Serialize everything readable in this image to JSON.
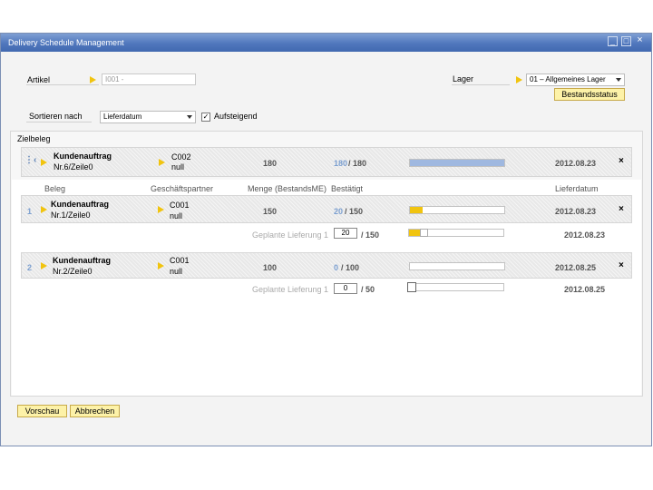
{
  "window": {
    "title": "Delivery Schedule Management"
  },
  "article": {
    "label": "Artikel",
    "value": "I001 - "
  },
  "warehouse": {
    "label": "Lager",
    "value": "01 – Allgemeines Lager",
    "status_button": "Bestandsstatus"
  },
  "sort": {
    "label": "Sortieren nach",
    "value": "Lieferdatum",
    "ascending_label": "Aufsteigend",
    "ascending_checked": true
  },
  "target_section": {
    "label": "Zielbeleg"
  },
  "target_doc": {
    "doc_type": "Kundenauftrag",
    "doc_ref": "Nr.6/Zeile0",
    "partner_code": "C002",
    "partner_name": "null",
    "quantity": "180",
    "confirmed": "180",
    "confirmed_total": "/ 180",
    "progress": 1.0,
    "date": "2012.08.23",
    "close": "×"
  },
  "columns": {
    "doc": "Beleg",
    "partner": "Geschäftspartner",
    "quantity": "Menge (BestandsME)",
    "confirmed": "Bestätigt",
    "date": "Lieferdatum"
  },
  "sources": [
    {
      "index": "1",
      "doc_type": "Kundenauftrag",
      "doc_ref": "Nr.1/Zeile0",
      "partner_code": "C001",
      "partner_name": "null",
      "quantity": "150",
      "confirmed": "20",
      "confirmed_total": "/ 150",
      "progress": 0.133,
      "date": "2012.08.23",
      "close": "×",
      "planned_label": "Geplante Lieferung 1",
      "planned_value": "20",
      "planned_total": "/ 150",
      "planned_progress": 0.133,
      "planned_date": "2012.08.23"
    },
    {
      "index": "2",
      "doc_type": "Kundenauftrag",
      "doc_ref": "Nr.2/Zeile0",
      "partner_code": "C001",
      "partner_name": "null",
      "quantity": "100",
      "confirmed": "0",
      "confirmed_total": "/ 100",
      "progress": 0.0,
      "date": "2012.08.25",
      "close": "×",
      "planned_label": "Geplante Lieferung 1",
      "planned_value": "0",
      "planned_total": "/ 50",
      "planned_progress": 0.0,
      "planned_date": "2012.08.25"
    }
  ],
  "footer": {
    "preview": "Vorschau",
    "cancel": "Abbrechen"
  },
  "colors": {
    "accent_yellow": "#f1c40f",
    "progress_blue": "#9fb8e0",
    "title_blue": "#5077bd"
  }
}
